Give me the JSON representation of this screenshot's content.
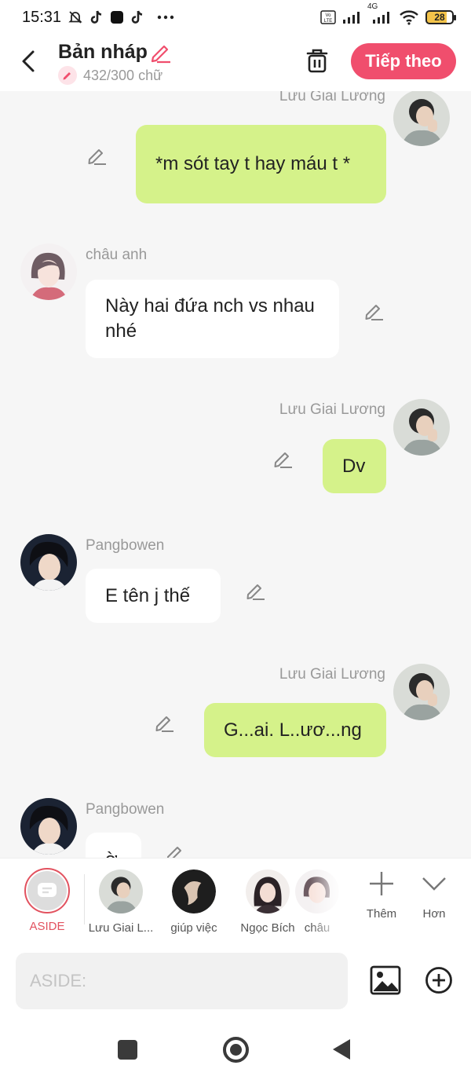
{
  "status_bar": {
    "time": "15:31",
    "network": "4G",
    "battery": "28",
    "icons": [
      "mute-icon",
      "tiktok-icon",
      "app-icon",
      "tiktok-icon",
      "more-dots-icon",
      "volte-icon",
      "signal-icon",
      "signal-4g-icon",
      "wifi-icon",
      "battery-icon"
    ]
  },
  "header": {
    "title": "Bản nháp",
    "word_count": "432/300 chữ",
    "next_label": "Tiếp theo"
  },
  "messages": [
    {
      "sender": "Lưu Giai Lương",
      "text": "*m sót tay t hay máu t *",
      "side": "right"
    },
    {
      "sender": "châu anh",
      "text": "Này hai đứa nch vs nhau nhé",
      "side": "left"
    },
    {
      "sender": "Lưu Giai Lương",
      "text": "Dv",
      "side": "right"
    },
    {
      "sender": "Pangbowen",
      "text": "E tên j thế",
      "side": "left"
    },
    {
      "sender": "Lưu Giai Lương",
      "text": "G...ai. L..ươ...ng",
      "side": "right"
    },
    {
      "sender": "Pangbowen",
      "text": "ờ",
      "side": "left"
    }
  ],
  "characters": {
    "aside": "ASIDE",
    "items": [
      "Lưu Giai L...",
      "giúp việc",
      "Ngọc Bích",
      "châu"
    ],
    "add_label": "Thêm",
    "more_label": "Hơn"
  },
  "input": {
    "placeholder": "ASIDE:"
  },
  "colors": {
    "accent": "#f04e6d",
    "my_bubble": "#d5f28a",
    "other_bubble": "#ffffff",
    "background": "#f6f6f6"
  }
}
